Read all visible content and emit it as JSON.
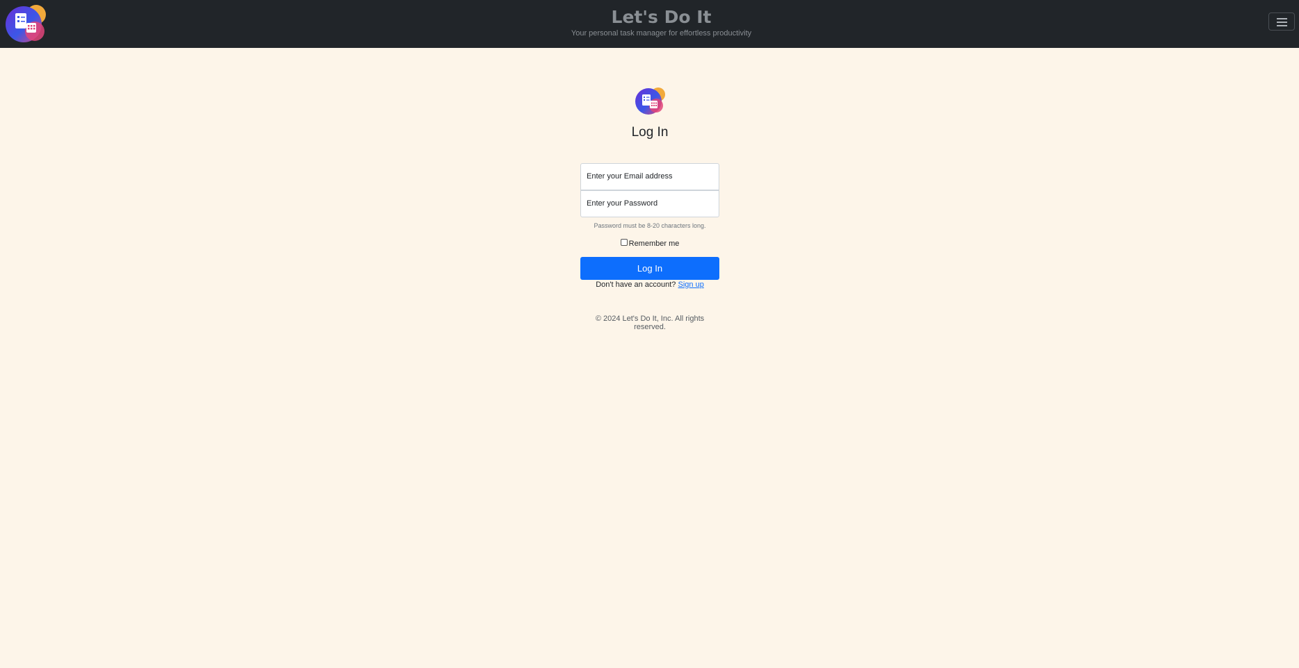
{
  "header": {
    "logo_icon": "app-logo",
    "title": "Let's Do It",
    "subtitle": "Your personal task manager for effortless productivity",
    "menu_icon": "hamburger-menu-icon"
  },
  "login": {
    "logo_icon": "app-logo",
    "heading": "Log In",
    "email_placeholder": "Enter your Email address",
    "password_placeholder": "Enter your Password",
    "password_help": "Password must be 8-20 characters long.",
    "remember_label": "Remember me",
    "remember_checked": false,
    "submit_label": "Log In",
    "signup_prompt": "Don't have an account?",
    "signup_link": "Sign up"
  },
  "footer": {
    "copyright": "© 2024 Let's Do It, Inc. All rights reserved."
  },
  "colors": {
    "navbar_bg": "#212529",
    "page_bg": "#fdf5e9",
    "primary": "#0d6efd"
  }
}
